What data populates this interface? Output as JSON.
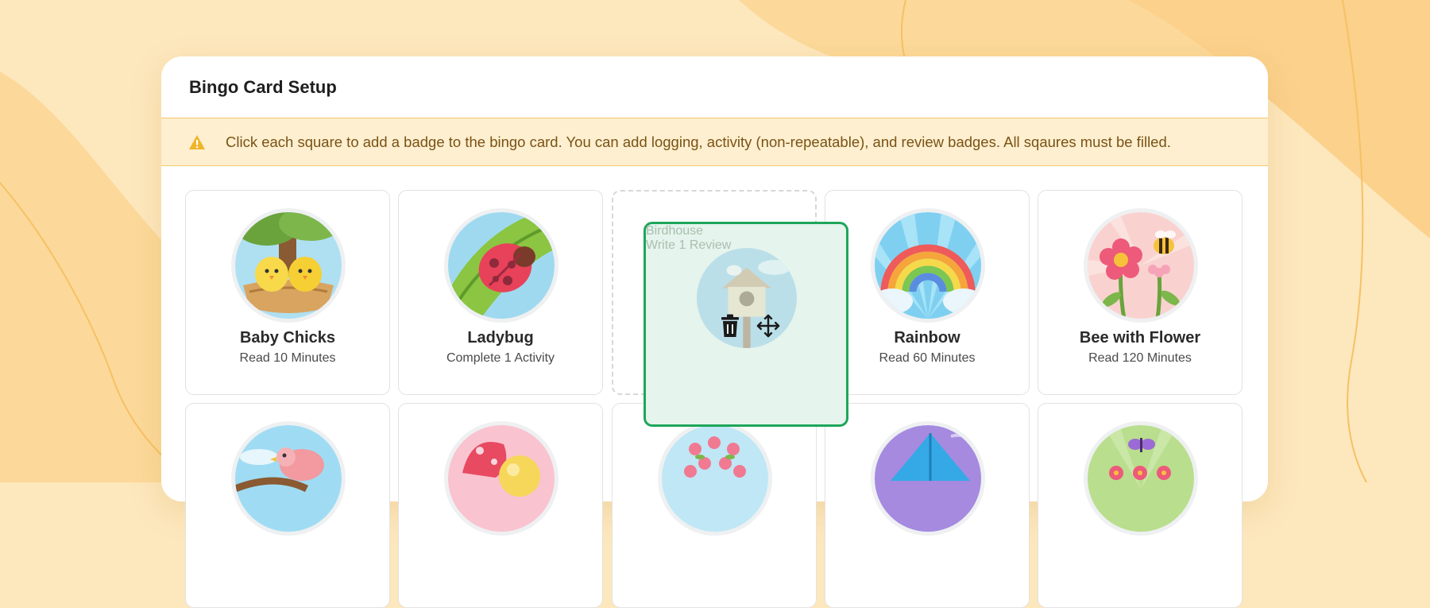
{
  "panel": {
    "title": "Bingo Card Setup",
    "notice": "Click each square to add a badge to the bingo card. You can add logging, activity (non-repeatable), and review badges. All sqaures must be filled."
  },
  "row1": [
    {
      "name": "Baby Chicks",
      "requirement": "Read 10 Minutes",
      "icon": "baby-chicks-badge"
    },
    {
      "name": "Ladybug",
      "requirement": "Complete 1 Activity",
      "icon": "ladybug-badge"
    },
    {
      "name": "",
      "requirement": "",
      "icon": "empty-slot"
    },
    {
      "name": "Rainbow",
      "requirement": "Read 60 Minutes",
      "icon": "rainbow-badge"
    },
    {
      "name": "Bee with Flower",
      "requirement": "Read 120 Minutes",
      "icon": "bee-flower-badge"
    }
  ],
  "dragging": {
    "name": "Birdhouse",
    "requirement": "Write 1 Review",
    "icon": "birdhouse-badge",
    "tools": [
      "trash-icon",
      "move-icon"
    ]
  },
  "row2_icons": [
    "bird-badge",
    "mushroom-badge",
    "blossom-tree-badge",
    "kite-badge",
    "flower-butterfly-badge"
  ],
  "colors": {
    "background": "#fde7bd",
    "notice_bg": "#fdefcf",
    "notice_border": "#f3c96b",
    "warning": "#f0b429",
    "drag_border": "#1ea65a",
    "drag_bg": "#e5f4ec"
  }
}
